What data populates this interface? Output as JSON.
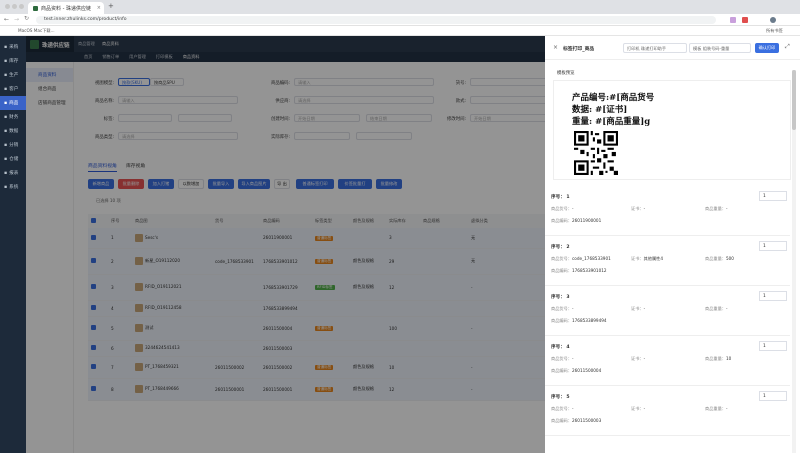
{
  "browser": {
    "tab_title": "商品资料 - 珠递供应链",
    "url": "test.inner.zhulinks.com/product/info",
    "bookmark": "所有书签",
    "bookmark_left": "MacOS Mac下载..."
  },
  "app": {
    "brand": "珠递供应链",
    "module": "商品管理",
    "breadcrumb": [
      "商品管理",
      "商品资料"
    ],
    "sidenav": [
      "采购",
      "库存",
      "生产",
      "客户",
      "商品",
      "财务",
      "数据",
      "分销",
      "仓储",
      "报表",
      "系统"
    ],
    "active_sidenav": 4,
    "menubar": [
      "首页",
      "销售订单",
      "用户管理",
      "打印模板",
      "商品资料"
    ],
    "subnav": [
      "商品资料",
      "组合商品",
      "店铺商品管理"
    ]
  },
  "filters": {
    "view_label": "视图模型:",
    "view_opt1": "按款(SKU)",
    "view_opt2": "按商品SPU",
    "code_label": "商品编码:",
    "code_ph": "请输入",
    "huohao_label": "货号:",
    "name_label": "商品名称:",
    "name_ph": "请输入",
    "supplier_label": "供应商:",
    "supplier_ph": "请选择",
    "brand_label": "款式:",
    "label_label": "标签:",
    "created_label": "创建时间:",
    "modified_label": "修改时间:",
    "type_label": "商品类型:",
    "type_ph": "请选择",
    "stock_label": "实际库存:",
    "start_ph": "开始日期",
    "end_ph": "结束日期"
  },
  "tabs": [
    "商品资料视角",
    "库存视角"
  ],
  "toolbar": [
    "新增商品",
    "批量删除",
    "加入打猪",
    "以数增加",
    "批量导入",
    "导入商品图片",
    "导 出",
    "普通标签打印",
    "价签批量打",
    "批量修改"
  ],
  "selected_count": "已选择 10 项",
  "table": {
    "headers": [
      "序号",
      "商品图",
      "货号",
      "商品编码",
      "标签类型",
      "颜色及规格",
      "实际库存",
      "商品规格",
      "虚拟分类"
    ],
    "rows": [
      {
        "no": "1",
        "name": "Sesc's",
        "huohao": "",
        "code": "26011900001",
        "tag": "普通标签",
        "spec": "",
        "stock": "3",
        "vc": "无"
      },
      {
        "no": "2",
        "name": "新星_O19112020",
        "huohao": "code_1768533901",
        "code": "1768533901012",
        "tag": "普通标签",
        "spec": "颜色及规格",
        "stock": "29",
        "vc": "无"
      },
      {
        "no": "3",
        "name": "RFID_O19112021",
        "huohao": "",
        "code": "1768533901729",
        "tag": "RFID标签",
        "spec": "颜色及规格",
        "stock": "12",
        "vc": "-"
      },
      {
        "no": "4",
        "name": "RFID_O19112458",
        "huohao": "",
        "code": "1768533899494",
        "tag": "",
        "spec": "",
        "stock": "",
        "vc": ""
      },
      {
        "no": "5",
        "name": "测试",
        "huohao": "",
        "code": "26011500004",
        "tag": "普通标签",
        "spec": "",
        "stock": "100",
        "vc": "-"
      },
      {
        "no": "6",
        "name": "3244624541413",
        "huohao": "",
        "code": "26011500003",
        "tag": "",
        "spec": "",
        "stock": "",
        "vc": ""
      },
      {
        "no": "7",
        "name": "PT_1768459321",
        "huohao": "26011500002",
        "code": "26011500002",
        "tag": "普通标签",
        "spec": "颜色及规格",
        "stock": "10",
        "vc": "-"
      },
      {
        "no": "8",
        "name": "PT_1768449666",
        "huohao": "26011500001",
        "code": "26011500001",
        "tag": "普通标签",
        "spec": "颜色及规格",
        "stock": "12",
        "vc": "-"
      }
    ]
  },
  "drawer": {
    "title": "标签打印_商品",
    "printer_label": "打印机",
    "printer_ph": "珠递打印助手",
    "template_label": "模板",
    "template_value": "组装号码-重量",
    "confirm": "确认打印",
    "preview_title": "模板预览",
    "preview_lines": [
      "产品编号:#[商品货号",
      "数据: #[证书]",
      "重量: #[商品重量]g"
    ],
    "field_code": "商品货号：",
    "field_cert": "证书：",
    "field_weight": "商品重量：",
    "field_no": "商品编码：",
    "records": [
      {
        "seq": "序号： 1",
        "qty": "1",
        "code": "-",
        "cert": "-",
        "weight": "-",
        "no": "26011900001"
      },
      {
        "seq": "序号： 2",
        "qty": "1",
        "code": "code_1768533901",
        "cert": "其他属性4",
        "weight": "500",
        "no": "1768533901012"
      },
      {
        "seq": "序号： 3",
        "qty": "1",
        "code": "-",
        "cert": "-",
        "weight": "-",
        "no": "1768533899494"
      },
      {
        "seq": "序号： 4",
        "qty": "1",
        "code": "-",
        "cert": "-",
        "weight": "10",
        "no": "26011500004"
      },
      {
        "seq": "序号： 5",
        "qty": "1",
        "code": "-",
        "cert": "-",
        "weight": "-",
        "no": "26011500003"
      }
    ]
  }
}
